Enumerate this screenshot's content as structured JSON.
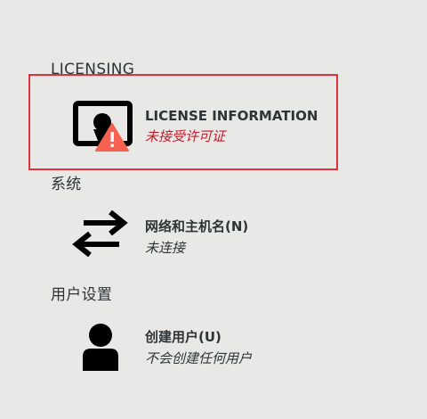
{
  "sections": {
    "licensing": "LICENSING",
    "system": "系统",
    "user_settings": "用户设置"
  },
  "spokes": {
    "license": {
      "title": "LICENSE INFORMATION",
      "status": "未接受许可证",
      "icon": "license-warning-icon"
    },
    "network": {
      "title": "网络和主机名(N)",
      "status": "未连接",
      "icon": "network-arrows-icon"
    },
    "user": {
      "title": "创建用户(U)",
      "status": "不会创建任何用户",
      "icon": "user-icon"
    }
  },
  "colors": {
    "background": "#e8e8e7",
    "warning_text": "#c01c28",
    "warning_icon": "#f66151",
    "highlight_border": "#e3303c"
  }
}
